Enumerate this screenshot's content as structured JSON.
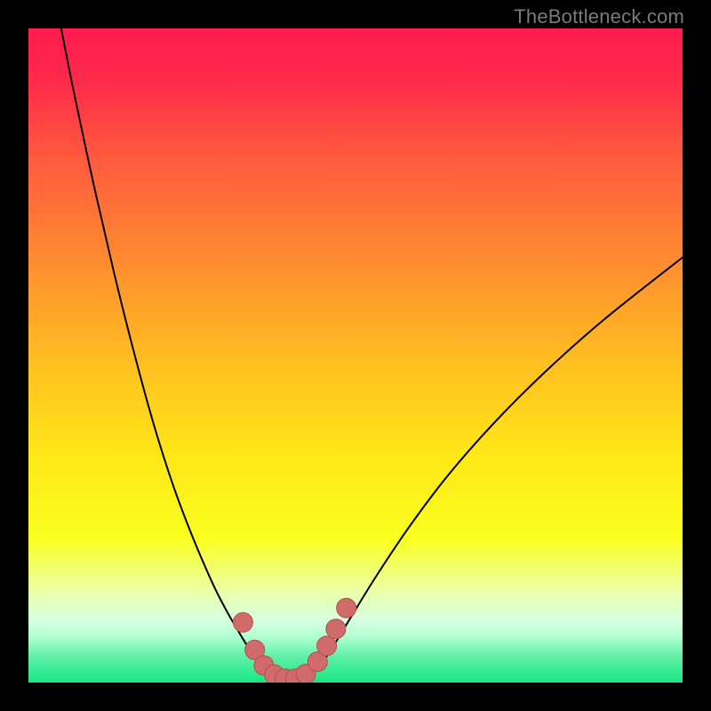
{
  "watermark": "TheBottleneck.com",
  "chart_data": {
    "type": "line",
    "title": "",
    "xlabel": "",
    "ylabel": "",
    "xlim": [
      0,
      100
    ],
    "ylim": [
      0,
      100
    ],
    "background_gradient": {
      "stops": [
        {
          "offset": 0.0,
          "color": "#ff1a4f"
        },
        {
          "offset": 0.08,
          "color": "#ff2a4a"
        },
        {
          "offset": 0.2,
          "color": "#ff5a3e"
        },
        {
          "offset": 0.35,
          "color": "#ff8a30"
        },
        {
          "offset": 0.5,
          "color": "#ffbb22"
        },
        {
          "offset": 0.65,
          "color": "#ffe617"
        },
        {
          "offset": 0.78,
          "color": "#f9ff1f"
        },
        {
          "offset": 0.86,
          "color": "#ecffa6"
        },
        {
          "offset": 0.905,
          "color": "#d6ffe0"
        },
        {
          "offset": 0.93,
          "color": "#b0ffd0"
        },
        {
          "offset": 0.96,
          "color": "#60f0a8"
        },
        {
          "offset": 1.0,
          "color": "#17e884"
        }
      ]
    },
    "series": [
      {
        "name": "bottleneck-curve",
        "color": "#000000",
        "stroke_width": 2,
        "points": [
          {
            "x": 5.0,
            "y": 100.0
          },
          {
            "x": 7.0,
            "y": 90.0
          },
          {
            "x": 10.0,
            "y": 76.0
          },
          {
            "x": 13.0,
            "y": 63.0
          },
          {
            "x": 16.0,
            "y": 51.0
          },
          {
            "x": 19.0,
            "y": 40.0
          },
          {
            "x": 22.0,
            "y": 30.5
          },
          {
            "x": 25.0,
            "y": 22.5
          },
          {
            "x": 28.0,
            "y": 15.5
          },
          {
            "x": 30.0,
            "y": 11.5
          },
          {
            "x": 32.0,
            "y": 8.0
          },
          {
            "x": 34.0,
            "y": 4.8
          },
          {
            "x": 36.0,
            "y": 2.3
          },
          {
            "x": 38.0,
            "y": 0.8
          },
          {
            "x": 40.0,
            "y": 0.2
          },
          {
            "x": 42.0,
            "y": 0.6
          },
          {
            "x": 44.0,
            "y": 2.0
          },
          {
            "x": 46.0,
            "y": 4.6
          },
          {
            "x": 49.0,
            "y": 9.5
          },
          {
            "x": 53.0,
            "y": 16.0
          },
          {
            "x": 58.0,
            "y": 23.5
          },
          {
            "x": 64.0,
            "y": 31.5
          },
          {
            "x": 71.0,
            "y": 39.5
          },
          {
            "x": 79.0,
            "y": 47.5
          },
          {
            "x": 88.0,
            "y": 55.5
          },
          {
            "x": 100.0,
            "y": 65.0
          }
        ]
      }
    ],
    "markers": {
      "color": "#d06b6b",
      "stroke": "#b64e4e",
      "radius": 11,
      "points": [
        {
          "x": 32.8,
          "y": 9.2
        },
        {
          "x": 34.6,
          "y": 5.0
        },
        {
          "x": 36.0,
          "y": 2.6
        },
        {
          "x": 37.6,
          "y": 1.2
        },
        {
          "x": 39.2,
          "y": 0.6
        },
        {
          "x": 40.8,
          "y": 0.6
        },
        {
          "x": 42.4,
          "y": 1.3
        },
        {
          "x": 44.2,
          "y": 3.2
        },
        {
          "x": 45.6,
          "y": 5.6
        },
        {
          "x": 47.0,
          "y": 8.2
        },
        {
          "x": 48.6,
          "y": 11.4
        }
      ]
    }
  }
}
